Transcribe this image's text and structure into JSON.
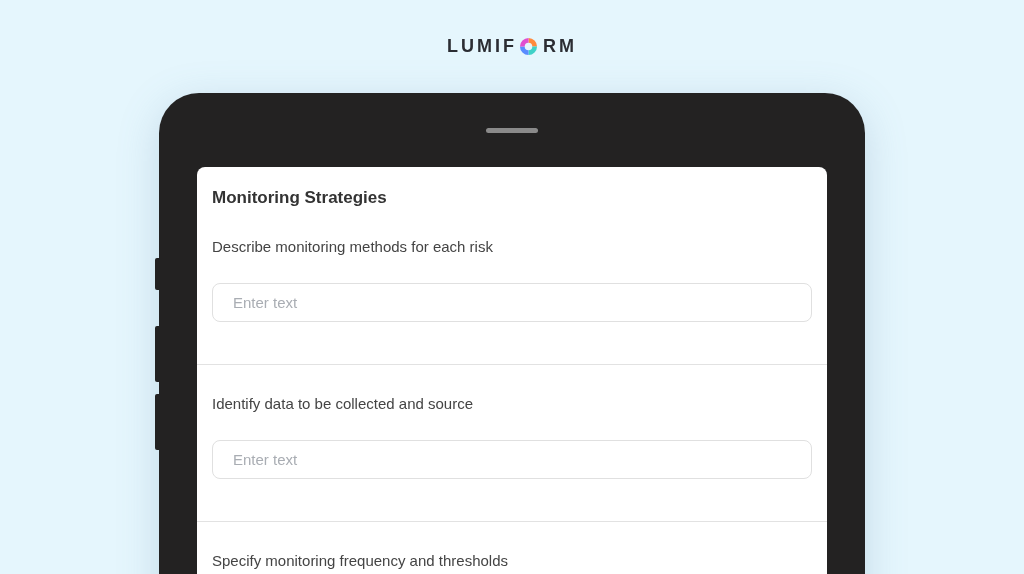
{
  "logo": {
    "before": "LUMIF",
    "after": "RM"
  },
  "form": {
    "title": "Monitoring Strategies",
    "questions": [
      {
        "label": "Describe monitoring methods for each risk",
        "placeholder": "Enter text"
      },
      {
        "label": "Identify data to be collected and source",
        "placeholder": "Enter text"
      },
      {
        "label": "Specify monitoring frequency and thresholds"
      }
    ]
  }
}
